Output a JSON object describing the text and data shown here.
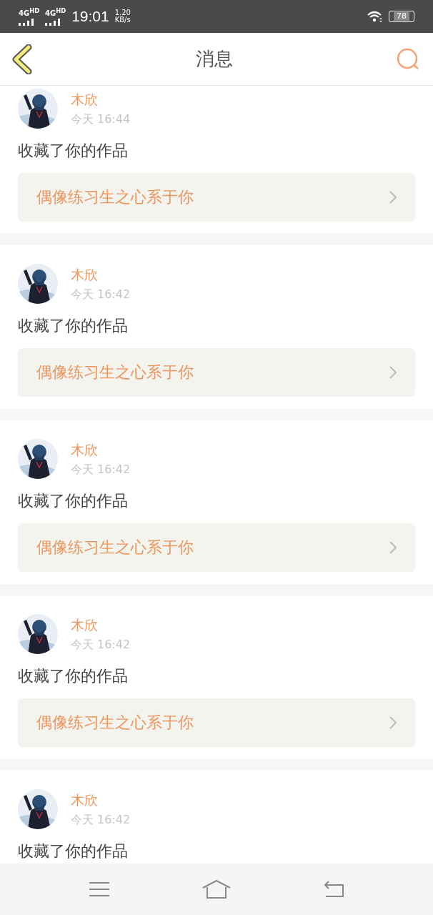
{
  "status_bar": {
    "networks": [
      "4G$^{HD}$",
      "4G$^{HD}$"
    ],
    "time": "19:01",
    "speed": "1.20",
    "speed_unit": "KB/s",
    "battery": "78"
  },
  "header": {
    "title": "消息"
  },
  "messages": [
    {
      "name": "木欣",
      "time": "今天 16:44",
      "text": "收藏了你的作品",
      "link": "偶像练习生之心系于你"
    },
    {
      "name": "木欣",
      "time": "今天 16:42",
      "text": "收藏了你的作品",
      "link": "偶像练习生之心系于你"
    },
    {
      "name": "木欣",
      "time": "今天 16:42",
      "text": "收藏了你的作品",
      "link": "偶像练习生之心系于你"
    },
    {
      "name": "木欣",
      "time": "今天 16:42",
      "text": "收藏了你的作品",
      "link": "偶像练习生之心系于你"
    },
    {
      "name": "木欣",
      "time": "今天 16:42",
      "text": "收藏了你的作品"
    }
  ]
}
